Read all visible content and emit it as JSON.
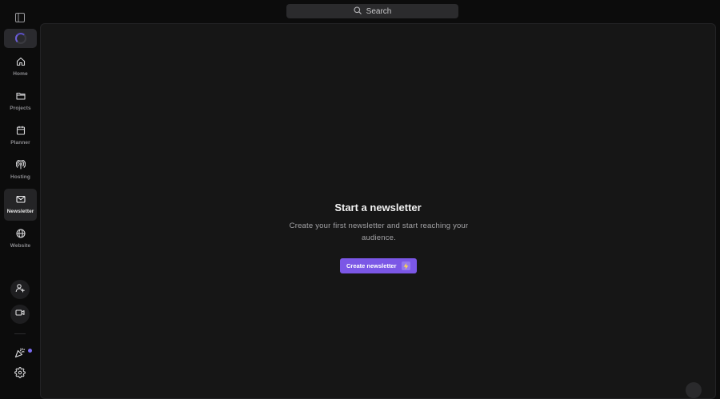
{
  "search": {
    "label": "Search"
  },
  "sidebar": {
    "items": [
      {
        "label": "Home",
        "icon": "home-icon"
      },
      {
        "label": "Projects",
        "icon": "folder-icon"
      },
      {
        "label": "Planner",
        "icon": "calendar-icon"
      },
      {
        "label": "Hosting",
        "icon": "podcast-icon"
      },
      {
        "label": "Newsletter",
        "icon": "mail-icon",
        "active": true
      },
      {
        "label": "Website",
        "icon": "globe-icon"
      }
    ],
    "bottom_icons": [
      "add-user-icon",
      "video-icon",
      "party-popper-icon",
      "gear-icon"
    ]
  },
  "empty_state": {
    "title": "Start a newsletter",
    "description": "Create your first newsletter and start reaching your audience.",
    "button_label": "Create newsletter"
  },
  "colors": {
    "accent": "#7b57e6",
    "background": "#0c0c0c",
    "panel": "#161616",
    "notification_dot": "#7c6cf2"
  }
}
